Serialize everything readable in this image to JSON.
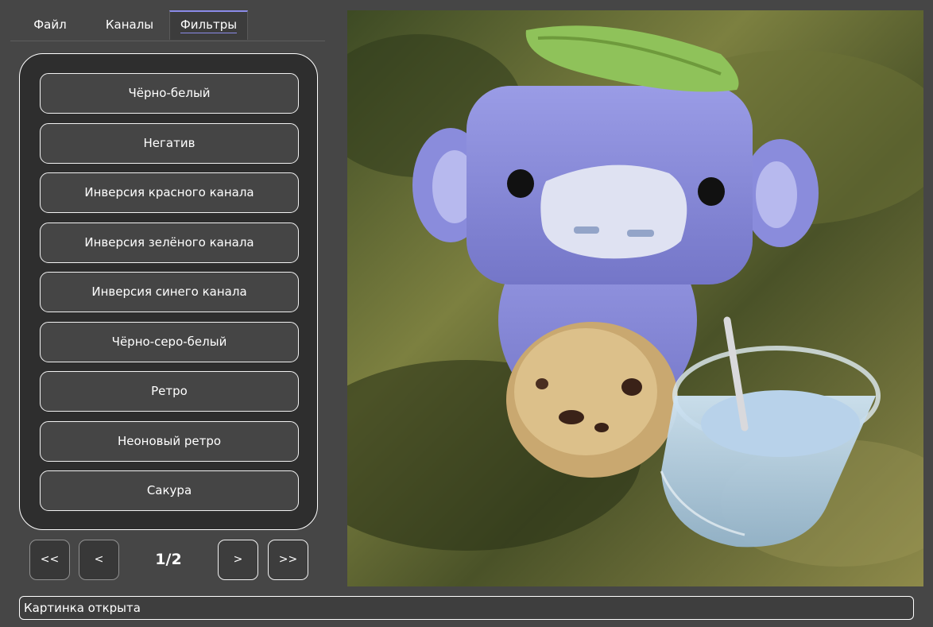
{
  "tabs": [
    {
      "label": "Файл",
      "active": false
    },
    {
      "label": "Каналы",
      "active": false
    },
    {
      "label": "Фильтры",
      "active": true
    }
  ],
  "filters": [
    "Чёрно-белый",
    "Негатив",
    "Инверсия красного канала",
    "Инверсия зелёного канала",
    "Инверсия синего канала",
    "Чёрно-серо-белый",
    "Ретро",
    "Неоновый ретро",
    "Сакура"
  ],
  "pager": {
    "first": "<<",
    "prev": "<",
    "indicator": "1/2",
    "next": ">",
    "last": ">>"
  },
  "image": {
    "description_icon": "photo-preview"
  },
  "status_text": "Картинка открыта",
  "colors": {
    "background": "#464646",
    "panel": "#2e2e2e",
    "button": "#454545",
    "accent": "#8b8be8"
  }
}
